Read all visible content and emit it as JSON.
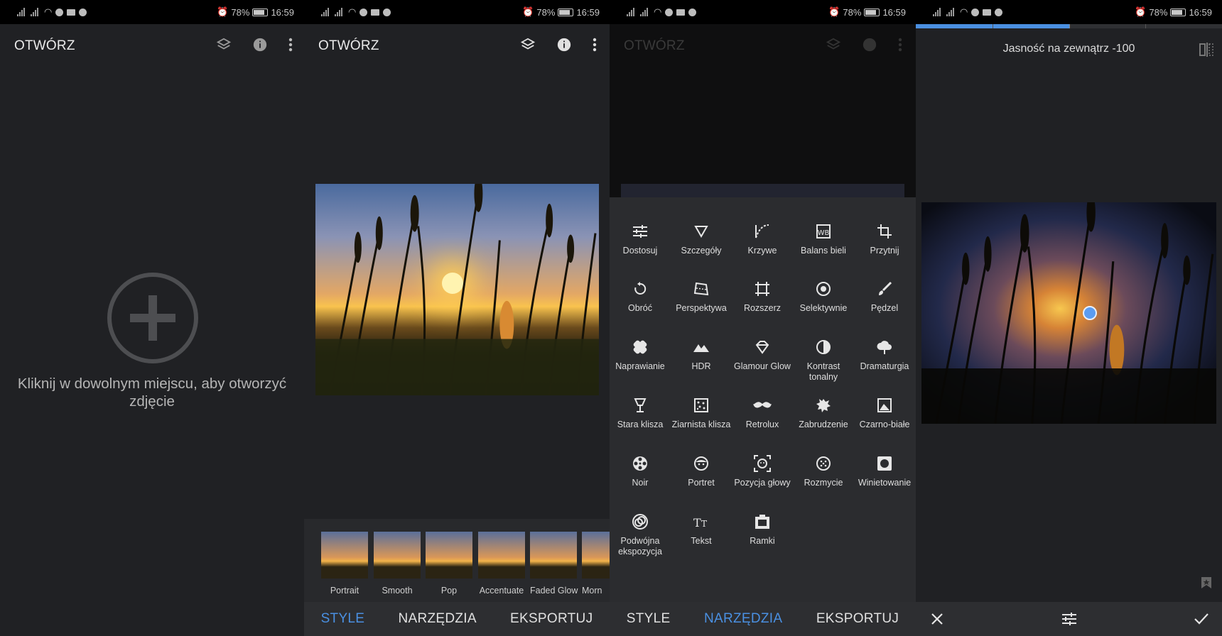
{
  "status": {
    "battery": "78%",
    "time": "16:59"
  },
  "panel1": {
    "title": "OTWÓRZ",
    "hint": "Kliknij w dowolnym miejscu, aby otworzyć zdjęcie",
    "icons": [
      "layers-icon",
      "info-icon",
      "more-vert-icon",
      "add-circle-icon"
    ]
  },
  "panel2": {
    "title": "OTWÓRZ",
    "styles": [
      "Portrait",
      "Smooth",
      "Pop",
      "Accentuate",
      "Faded Glow",
      "Morn"
    ],
    "nav": [
      "STYLE",
      "NARZĘDZIA",
      "EKSPORTUJ"
    ],
    "active_nav": "STYLE"
  },
  "panel3": {
    "title": "OTWÓRZ",
    "tools": [
      [
        "Dostosuj",
        "tune-icon"
      ],
      [
        "Szczegóły",
        "triangle-icon"
      ],
      [
        "Krzywe",
        "curves-icon"
      ],
      [
        "Balans bieli",
        "white-balance-icon"
      ],
      [
        "Przytnij",
        "crop-icon"
      ],
      [
        "Obróć",
        "rotate-icon"
      ],
      [
        "Perspektywa",
        "perspective-icon"
      ],
      [
        "Rozszerz",
        "expand-icon"
      ],
      [
        "Selektywnie",
        "selective-icon"
      ],
      [
        "Pędzel",
        "brush-icon"
      ],
      [
        "Naprawianie",
        "healing-icon"
      ],
      [
        "HDR",
        "hdr-icon"
      ],
      [
        "Glamour Glow",
        "glamour-icon"
      ],
      [
        "Kontrast tonalny",
        "tonal-icon"
      ],
      [
        "Dramaturgia",
        "cloud-icon"
      ],
      [
        "Stara klisza",
        "lamp-icon"
      ],
      [
        "Ziarnista klisza",
        "grain-icon"
      ],
      [
        "Retrolux",
        "mustache-icon"
      ],
      [
        "Zabrudzenie",
        "grunge-icon"
      ],
      [
        "Czarno-białe",
        "bw-icon"
      ],
      [
        "Noir",
        "film-reel-icon"
      ],
      [
        "Portret",
        "face-icon"
      ],
      [
        "Pozycja głowy",
        "head-pose-icon"
      ],
      [
        "Rozmycie",
        "blur-icon"
      ],
      [
        "Winietowanie",
        "vignette-icon"
      ],
      [
        "Podwójna ekspozycja",
        "double-exposure-icon"
      ],
      [
        "Tekst",
        "text-icon"
      ],
      [
        "Ramki",
        "frames-icon"
      ]
    ],
    "nav": [
      "STYLE",
      "NARZĘDZIA",
      "EKSPORTUJ"
    ],
    "active_nav": "NARZĘDZIA"
  },
  "panel4": {
    "adjust_label": "Jasność na zewnątrz -100",
    "slider_fraction": 0.5,
    "icons": [
      "compare-icon",
      "bookmark-icon",
      "close-icon",
      "tune-icon",
      "check-icon"
    ]
  }
}
